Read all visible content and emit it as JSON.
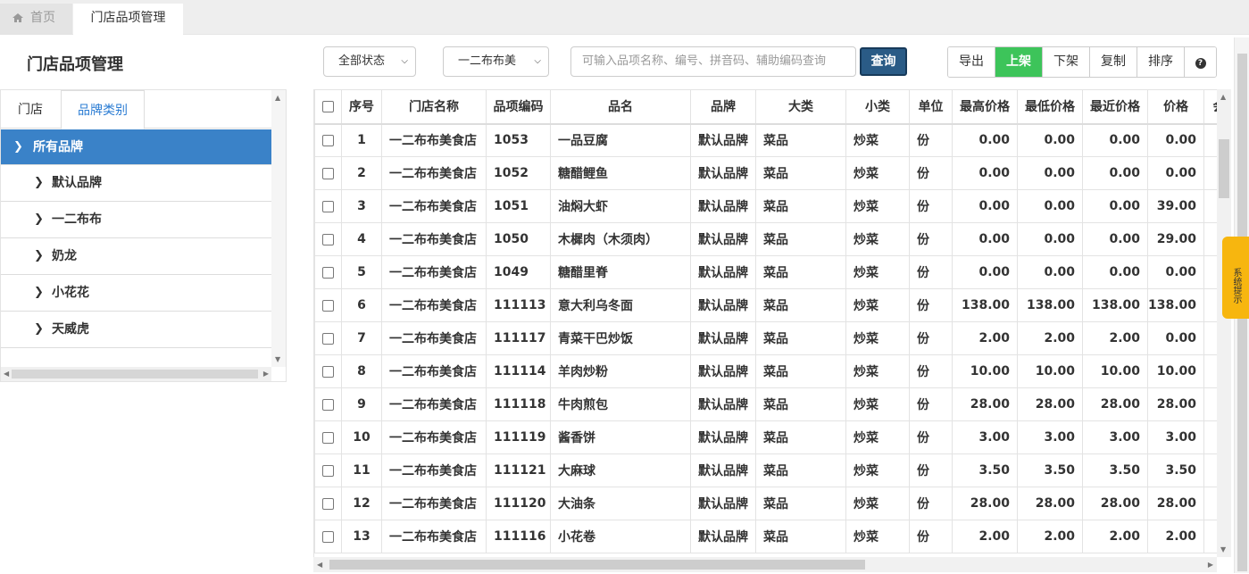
{
  "tabs": {
    "home": "首页",
    "active": "门店品项管理"
  },
  "page": {
    "title": "门店品项管理"
  },
  "filters": {
    "status": "全部状态",
    "store": "一二布布美",
    "search_placeholder": "可输入品项名称、编号、拼音码、辅助编码查询",
    "query_label": "查询"
  },
  "toolbar": {
    "export": "导出",
    "on_shelf": "上架",
    "off_shelf": "下架",
    "copy": "复制",
    "sort": "排序",
    "help": "?"
  },
  "left_panel": {
    "tab_store": "门店",
    "tab_brand": "品牌类别",
    "tree": {
      "root": "所有品牌",
      "children": [
        "默认品牌",
        "一二布布",
        "奶龙",
        "小花花",
        "天威虎"
      ]
    }
  },
  "table": {
    "columns": [
      "序号",
      "门店名称",
      "品项编码",
      "品名",
      "品牌",
      "大类",
      "小类",
      "单位",
      "最高价格",
      "最低价格",
      "最近价格",
      "价格",
      "会"
    ],
    "rows": [
      [
        "1",
        "一二布布美食店",
        "1053",
        "一品豆腐",
        "默认品牌",
        "菜品",
        "炒菜",
        "份",
        "0.00",
        "0.00",
        "0.00",
        "0.00"
      ],
      [
        "2",
        "一二布布美食店",
        "1052",
        "糖醋鲤鱼",
        "默认品牌",
        "菜品",
        "炒菜",
        "份",
        "0.00",
        "0.00",
        "0.00",
        "0.00"
      ],
      [
        "3",
        "一二布布美食店",
        "1051",
        "油焖大虾",
        "默认品牌",
        "菜品",
        "炒菜",
        "份",
        "0.00",
        "0.00",
        "0.00",
        "39.00"
      ],
      [
        "4",
        "一二布布美食店",
        "1050",
        "木樨肉（木须肉）",
        "默认品牌",
        "菜品",
        "炒菜",
        "份",
        "0.00",
        "0.00",
        "0.00",
        "29.00"
      ],
      [
        "5",
        "一二布布美食店",
        "1049",
        "糖醋里脊",
        "默认品牌",
        "菜品",
        "炒菜",
        "份",
        "0.00",
        "0.00",
        "0.00",
        "0.00"
      ],
      [
        "6",
        "一二布布美食店",
        "111113",
        "意大利乌冬面",
        "默认品牌",
        "菜品",
        "炒菜",
        "份",
        "138.00",
        "138.00",
        "138.00",
        "138.00"
      ],
      [
        "7",
        "一二布布美食店",
        "111117",
        "青菜干巴炒饭",
        "默认品牌",
        "菜品",
        "炒菜",
        "份",
        "2.00",
        "2.00",
        "2.00",
        "0.00"
      ],
      [
        "8",
        "一二布布美食店",
        "111114",
        "羊肉炒粉",
        "默认品牌",
        "菜品",
        "炒菜",
        "份",
        "10.00",
        "10.00",
        "10.00",
        "10.00"
      ],
      [
        "9",
        "一二布布美食店",
        "111118",
        "牛肉煎包",
        "默认品牌",
        "菜品",
        "炒菜",
        "份",
        "28.00",
        "28.00",
        "28.00",
        "28.00"
      ],
      [
        "10",
        "一二布布美食店",
        "111119",
        "酱香饼",
        "默认品牌",
        "菜品",
        "炒菜",
        "份",
        "3.00",
        "3.00",
        "3.00",
        "3.00"
      ],
      [
        "11",
        "一二布布美食店",
        "111121",
        "大麻球",
        "默认品牌",
        "菜品",
        "炒菜",
        "份",
        "3.50",
        "3.50",
        "3.50",
        "3.50"
      ],
      [
        "12",
        "一二布布美食店",
        "111120",
        "大油条",
        "默认品牌",
        "菜品",
        "炒菜",
        "份",
        "28.00",
        "28.00",
        "28.00",
        "28.00"
      ],
      [
        "13",
        "一二布布美食店",
        "111116",
        "小花卷",
        "默认品牌",
        "菜品",
        "炒菜",
        "份",
        "2.00",
        "2.00",
        "2.00",
        "2.00"
      ]
    ]
  },
  "system_tip": "系统提示",
  "colors": {
    "primary": "#3a82c8",
    "green": "#3dc45a",
    "query_btn": "#2a5b86",
    "tip": "#f7b60f"
  }
}
